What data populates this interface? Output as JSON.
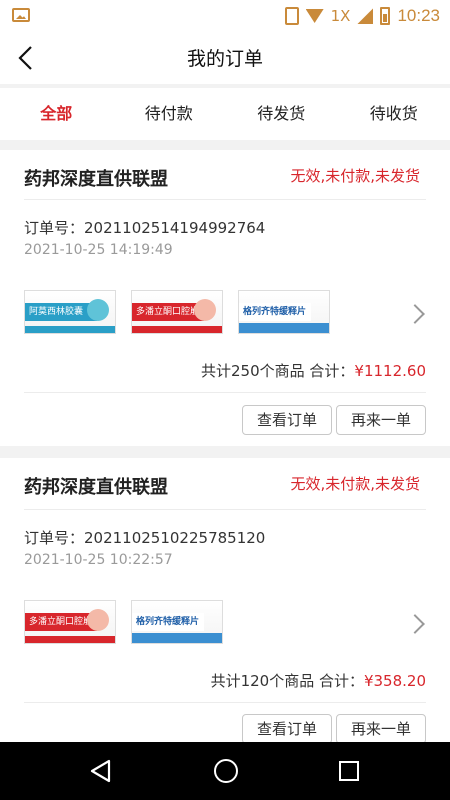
{
  "status_bar": {
    "network": "1X",
    "time": "10:23"
  },
  "nav": {
    "title": "我的订单"
  },
  "tabs": [
    {
      "label": "全部",
      "active": true
    },
    {
      "label": "待付款",
      "active": false
    },
    {
      "label": "待发货",
      "active": false
    },
    {
      "label": "待收货",
      "active": false
    }
  ],
  "orders": [
    {
      "store": "药邦深度直供联盟",
      "status": "无效,未付款,未发货",
      "order_no": "订单号：20211025141949927​64",
      "time": "2021-10-25 14:19:49",
      "products": [
        "阿莫西林胶囊",
        "多潘立酮口腔崩解片",
        "格列齐特缓释片"
      ],
      "summary": "共计250个商品 合计：",
      "amount": "¥1112.60",
      "btn_view": "查看订单",
      "btn_reorder": "再来一单"
    },
    {
      "store": "药邦深度直供联盟",
      "status": "无效,未付款,未发货",
      "order_no": "订单号：20211025102257851​20",
      "time": "2021-10-25 10:22:57",
      "products": [
        "多潘立酮口腔崩解片",
        "格列齐特缓释片"
      ],
      "summary": "共计120个商品 合计：",
      "amount": "¥358.20",
      "btn_view": "查看订单",
      "btn_reorder": "再来一单"
    }
  ],
  "colors": {
    "accent": "#d8262c",
    "status_icon": "#c98a3a"
  }
}
